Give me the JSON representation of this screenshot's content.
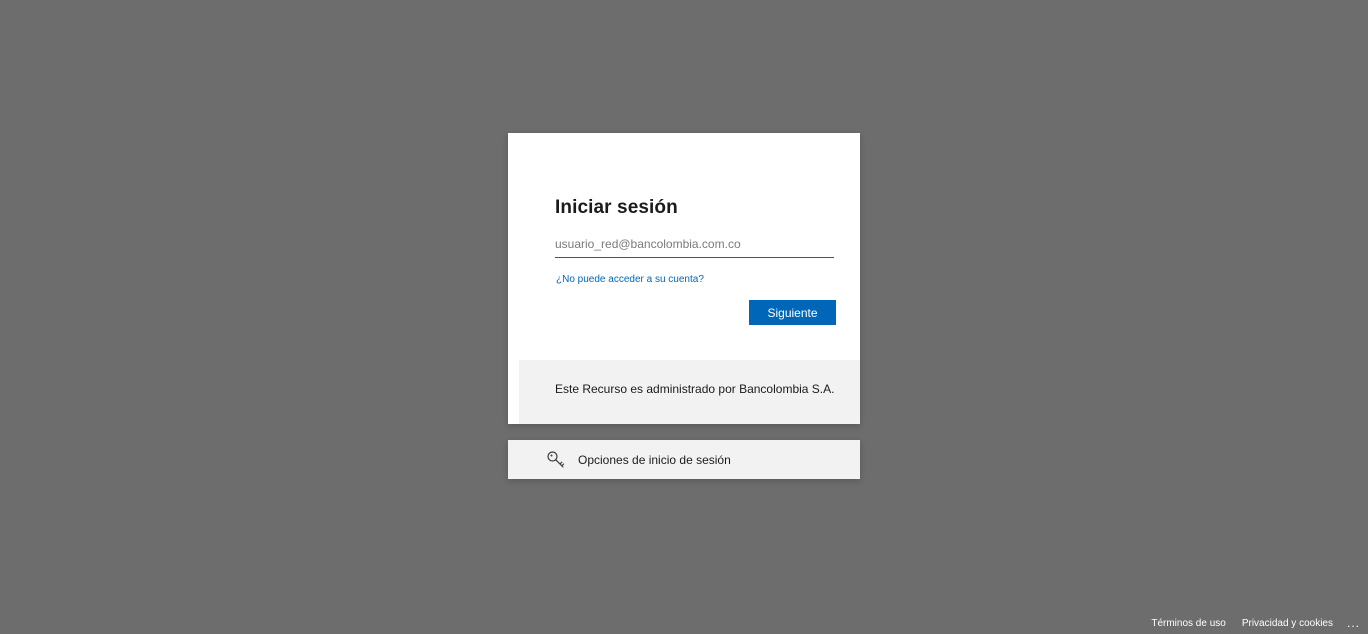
{
  "signin": {
    "title": "Iniciar sesión",
    "email_placeholder": "usuario_red@bancolombia.com.co",
    "email_value": "",
    "cant_access_link": "¿No puede acceder a su cuenta?",
    "next_button": "Siguiente",
    "admin_note": "Este Recurso es administrado por Bancolombia S.A."
  },
  "signin_options": {
    "label": "Opciones de inicio de sesión",
    "icon": "key-icon"
  },
  "footer": {
    "terms": "Términos de uso",
    "privacy": "Privacidad y cookies",
    "more": "..."
  },
  "colors": {
    "background": "#6d6d6d",
    "accent": "#0067b8",
    "panel": "#ffffff",
    "muted_panel": "#f2f2f2"
  }
}
